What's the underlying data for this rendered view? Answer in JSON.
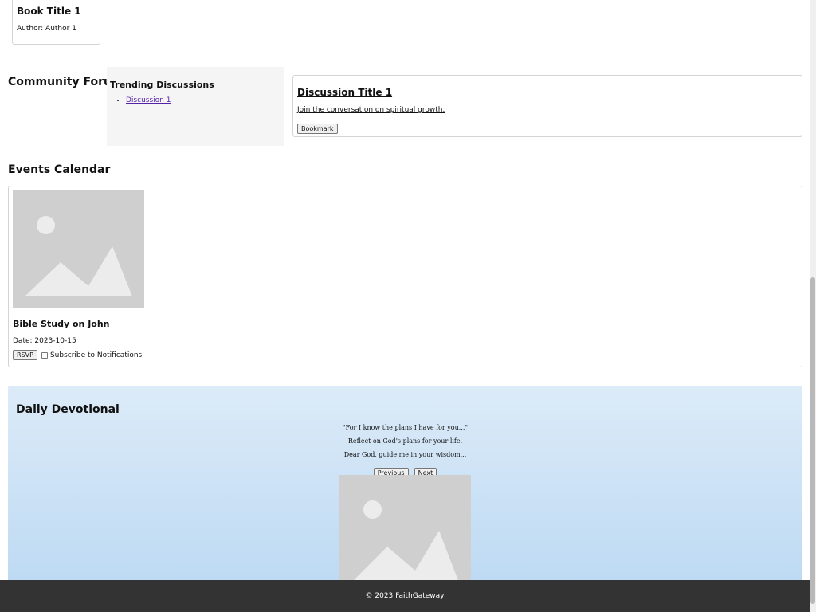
{
  "book": {
    "title": "Book Title 1",
    "author": "Author: Author 1"
  },
  "forum": {
    "heading": "Community Forum",
    "trending_title": "Trending Discussions",
    "trending_items": [
      "Discussion 1"
    ],
    "discussion_title": "Discussion Title 1",
    "discussion_text": "Join the conversation on spiritual growth.",
    "bookmark_label": "Bookmark"
  },
  "events": {
    "heading": "Events Calendar",
    "image_icon": "image-placeholder-icon",
    "title": "Bible Study on John",
    "date": "Date: 2023-10-15",
    "rsvp_label": "RSVP",
    "subscribe_label": "Subscribe to Notifications"
  },
  "devotional": {
    "heading": "Daily Devotional",
    "verse": "\"For I know the plans I have for you...\"",
    "reflection": "Reflect on God's plans for your life.",
    "prayer": "Dear God, guide me in your wisdom...",
    "previous_label": "Previous",
    "next_label": "Next"
  },
  "footer": {
    "text": "© 2023 FaithGateway"
  },
  "colors": {
    "footer_bg": "#333333",
    "devotional_bg_top": "#dcebf8",
    "devotional_bg_bottom": "#bcd9f3",
    "link": "#5522aa"
  }
}
